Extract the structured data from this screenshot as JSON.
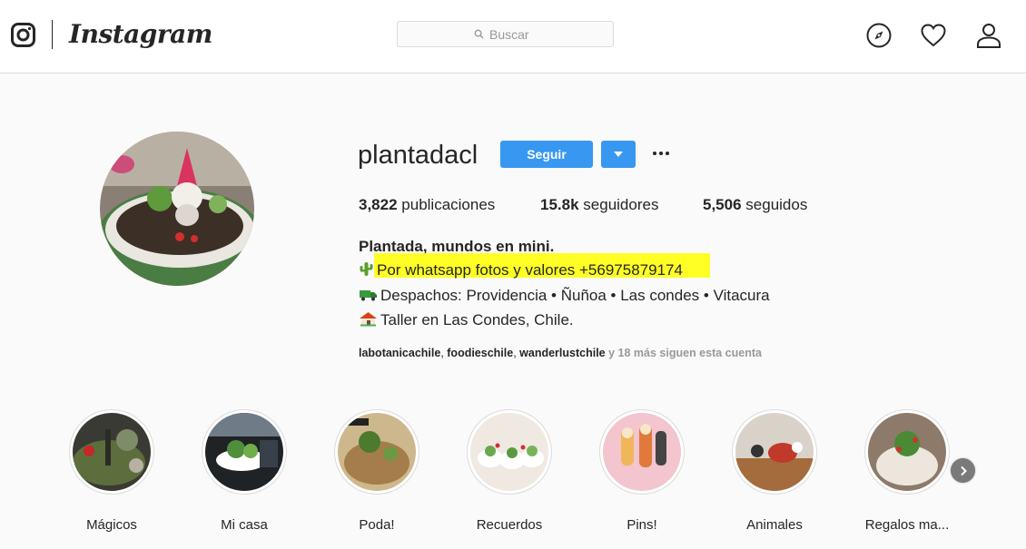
{
  "nav": {
    "brand": "Instagram",
    "search_placeholder": "Buscar",
    "icons": [
      "instagram-glyph-icon",
      "search-icon",
      "compass-icon",
      "heart-icon",
      "person-icon"
    ]
  },
  "profile": {
    "username": "plantadacl",
    "follow_label": "Seguir",
    "stats": {
      "posts_value": "3,822",
      "posts_label": "publicaciones",
      "followers_value": "15.8k",
      "followers_label": "seguidores",
      "following_value": "5,506",
      "following_label": "seguidos"
    },
    "bio": {
      "name": "Plantada, mundos en mini.",
      "line1": "Por whatsapp fotos y valores +56975879174",
      "line2": "Despachos: Providencia • Ñuñoa • Las condes • Vitacura",
      "line3": "Taller en Las Condes, Chile.",
      "emojis": [
        "cactus",
        "truck",
        "house"
      ],
      "highlight_color": "#ffff00"
    },
    "followed_by": {
      "user1": "labotanicachile",
      "user2": "foodieschile",
      "user3": "wanderlustchile",
      "more": "y 18 más siguen esta cuenta"
    }
  },
  "highlights": [
    {
      "label": "Mágicos"
    },
    {
      "label": "Mi casa"
    },
    {
      "label": "Poda!"
    },
    {
      "label": "Recuerdos"
    },
    {
      "label": "Pins!"
    },
    {
      "label": "Animales"
    },
    {
      "label": "Regalos ma..."
    }
  ],
  "colors": {
    "accent": "#3897f0",
    "text": "#262626",
    "muted": "#999999",
    "border": "#dbdbdb"
  }
}
